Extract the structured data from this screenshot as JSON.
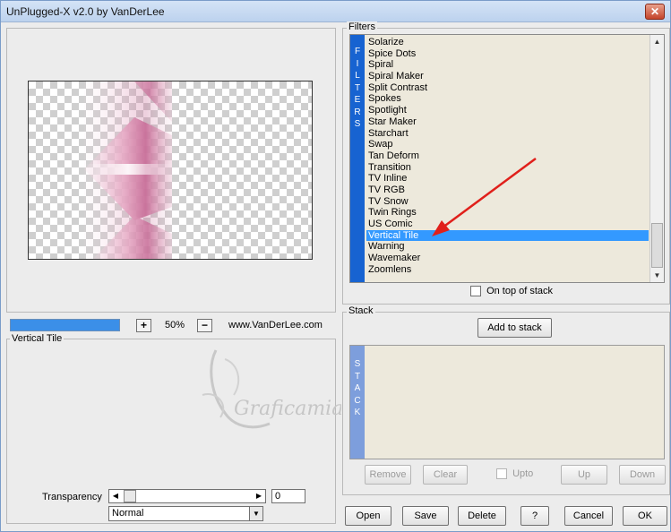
{
  "window": {
    "title": "UnPlugged-X v2.0 by VanDerLee",
    "close_glyph": "✕"
  },
  "zoom": {
    "plus": "+",
    "minus": "−",
    "value": "50%"
  },
  "website": "www.VanDerLee.com",
  "filters": {
    "group_label": "Filters",
    "strip_letters": [
      "F",
      "I",
      "L",
      "T",
      "E",
      "R",
      "S"
    ],
    "items": [
      "Solarize",
      "Spice Dots",
      "Spiral",
      "Spiral Maker",
      "Split Contrast",
      "Spokes",
      "Spotlight",
      "Star Maker",
      "Starchart",
      "Swap",
      "Tan Deform",
      "Transition",
      "TV Inline",
      "TV RGB",
      "TV Snow",
      "Twin Rings",
      "US Comic",
      "Vertical Tile",
      "Warning",
      "Wavemaker",
      "Zoomlens"
    ],
    "selected": "Vertical Tile",
    "on_top_label": "On top of stack"
  },
  "stack": {
    "group_label": "Stack",
    "add_button": "Add to stack",
    "strip_letters": [
      "S",
      "T",
      "A",
      "C",
      "K"
    ],
    "remove": "Remove",
    "clear": "Clear",
    "upto": "Upto",
    "up": "Up",
    "down": "Down"
  },
  "params": {
    "group_label": "Vertical Tile",
    "transparency_label": "Transparency",
    "transparency_value": "0",
    "blend_mode": "Normal"
  },
  "buttons": {
    "open": "Open",
    "save": "Save",
    "delete": "Delete",
    "help": "?",
    "cancel": "Cancel",
    "ok": "OK"
  },
  "watermark": "Graficamia",
  "colors": {
    "selection": "#3399ff",
    "filter_strip": "#1763d1",
    "stack_strip": "#7d9edc",
    "arrow": "#e0201b",
    "preview_pink": "#d98fb0"
  }
}
